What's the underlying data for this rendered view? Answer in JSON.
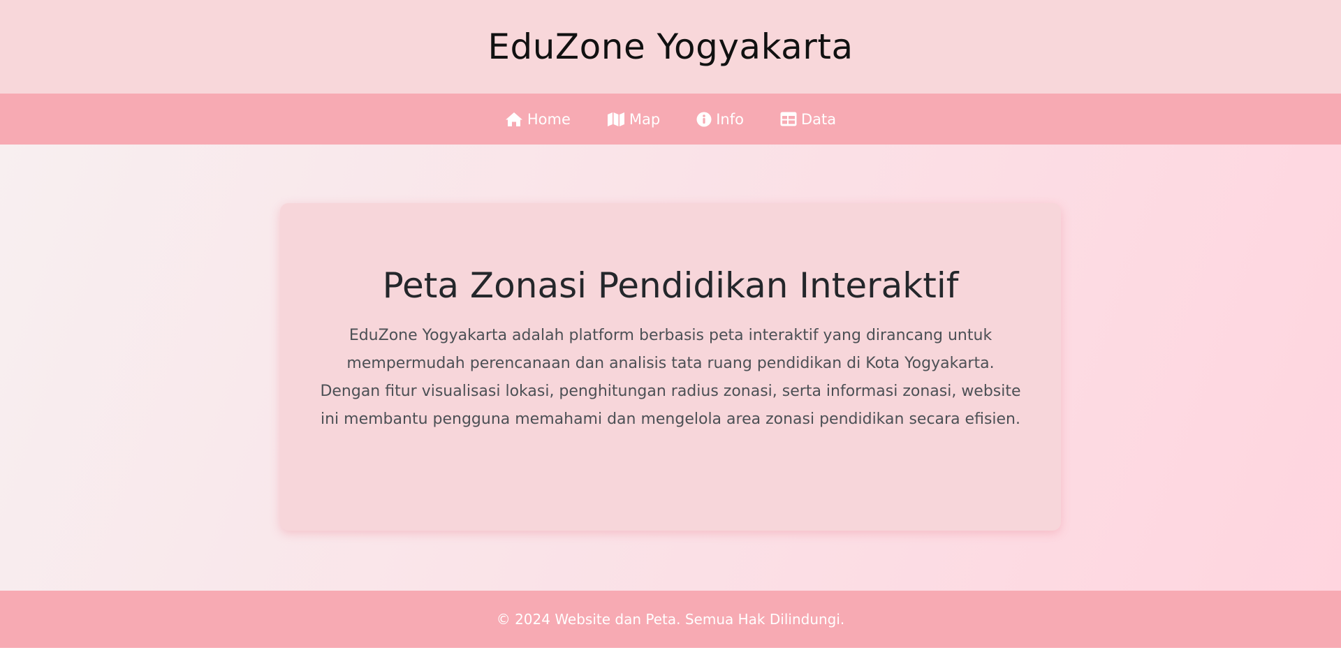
{
  "header": {
    "title": "EduZone Yogyakarta"
  },
  "nav": {
    "items": [
      {
        "label": "Home",
        "icon": "home-icon"
      },
      {
        "label": "Map",
        "icon": "map-icon"
      },
      {
        "label": "Info",
        "icon": "info-circle-icon"
      },
      {
        "label": "Data",
        "icon": "table-icon"
      }
    ]
  },
  "hero": {
    "title": "Peta Zonasi Pendidikan Interaktif",
    "description": "EduZone Yogyakarta adalah platform berbasis peta interaktif yang dirancang untuk mempermudah perencanaan dan analisis tata ruang pendidikan di Kota Yogyakarta. Dengan fitur visualisasi lokasi, penghitungan radius zonasi, serta informasi zonasi, website ini membantu pengguna memahami dan mengelola area zonasi pendidikan secara efisien."
  },
  "footer": {
    "text": "© 2024 Website dan Peta. Semua Hak Dilindungi."
  },
  "colors": {
    "header_bg": "#f8d7da",
    "nav_bg": "#f7aab3",
    "card_bg": "#f7d6da",
    "text_dark": "#24272b",
    "text_muted": "#4c5055",
    "nav_text": "#ffffff"
  }
}
